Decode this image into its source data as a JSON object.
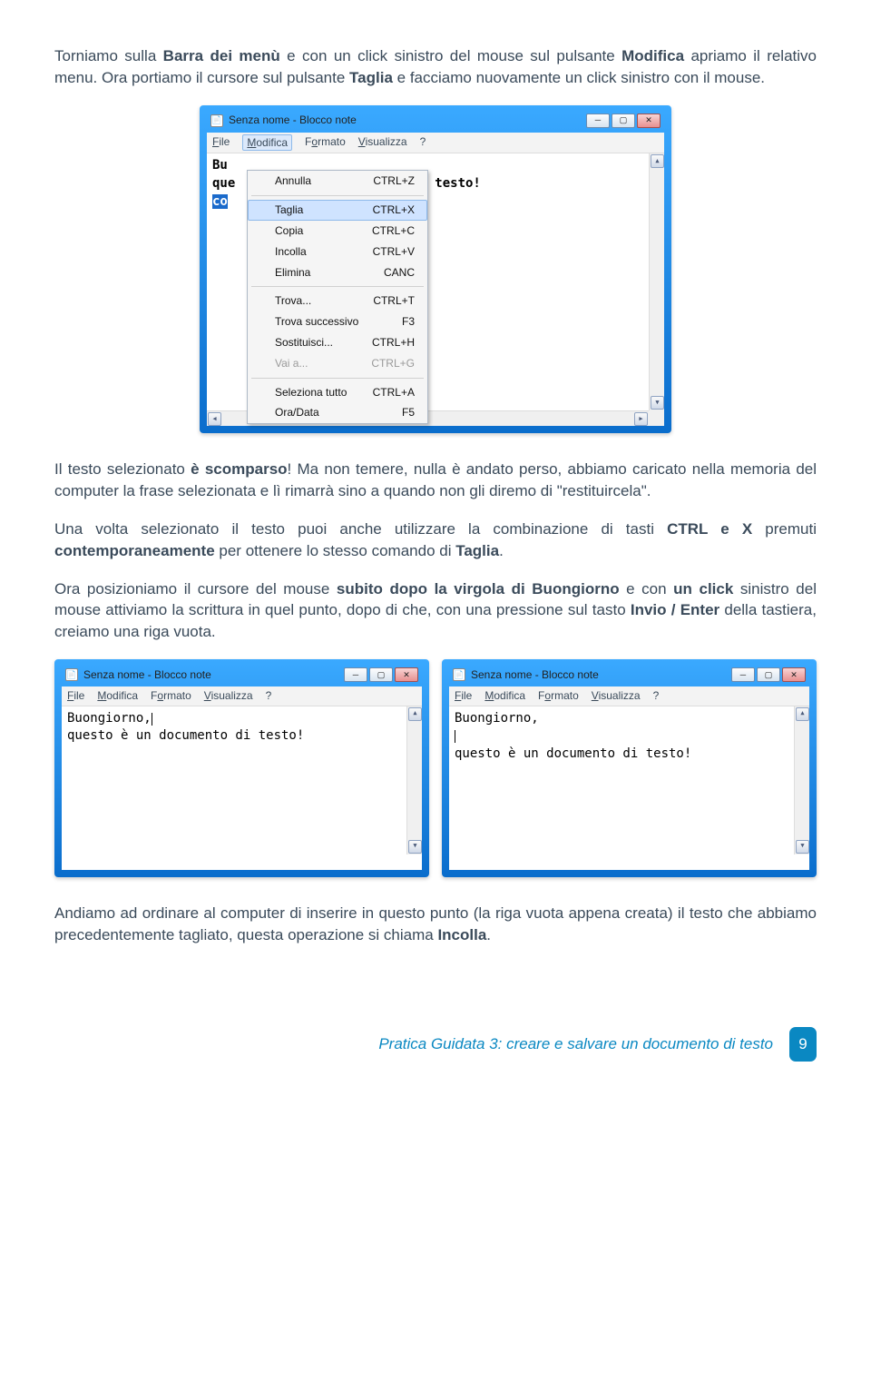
{
  "paragraphs": {
    "p1a": "Torniamo sulla ",
    "p1b": "Barra dei menù",
    "p1c": " e con un click sinistro del mouse sul pulsante ",
    "p1d": "Modifica",
    "p1e": " apriamo il relativo menu. Ora portiamo il cursore sul pulsante ",
    "p1f": "Taglia",
    "p1g": " e facciamo nuovamente un click sinistro con il mouse.",
    "p2a": "Il testo selezionato ",
    "p2b": "è scomparso",
    "p2c": "! Ma non temere, nulla è andato perso, abbiamo caricato nella memoria del computer la frase selezionata e lì rimarrà sino a quando non gli diremo di \"restituircela\".",
    "p3a": "Una volta selezionato il testo puoi anche utilizzare la combinazione di tasti ",
    "p3b": "CTRL e X",
    "p3c": " premuti ",
    "p3d": "contemporaneamente",
    "p3e": " per ottenere lo stesso comando di ",
    "p3f": "Taglia",
    "p3g": ".",
    "p4a": "Ora posizioniamo il cursore del mouse ",
    "p4b": "subito dopo la virgola di Buongiorno",
    "p4c": " e con ",
    "p4d": "un click",
    "p4e": " sinistro del mouse attiviamo la scrittura in quel punto, dopo di che, con una pressione sul tasto ",
    "p4f": "Invio / Enter",
    "p4g": " della tastiera, creiamo una riga vuota.",
    "p5a": "Andiamo ad ordinare al computer di inserire in questo punto (la riga vuota appena creata) il testo che abbiamo precedentemente tagliato, questa operazione si chiama ",
    "p5b": "Incolla",
    "p5c": "."
  },
  "notepad": {
    "title": "Senza nome - Blocco note",
    "menus": {
      "file": "File",
      "modifica": "Modifica",
      "formato": "Formato",
      "visualizza": "Visualizza",
      "help": "?"
    }
  },
  "dropdown": [
    {
      "label": "Annulla",
      "shortcut": "CTRL+Z",
      "gray": false
    },
    {
      "sep": true
    },
    {
      "label": "Taglia",
      "shortcut": "CTRL+X",
      "highlight": true
    },
    {
      "label": "Copia",
      "shortcut": "CTRL+C"
    },
    {
      "label": "Incolla",
      "shortcut": "CTRL+V"
    },
    {
      "label": "Elimina",
      "shortcut": "CANC"
    },
    {
      "sep": true
    },
    {
      "label": "Trova...",
      "shortcut": "CTRL+T"
    },
    {
      "label": "Trova successivo",
      "shortcut": "F3"
    },
    {
      "label": "Sostituisci...",
      "shortcut": "CTRL+H"
    },
    {
      "label": "Vai a...",
      "shortcut": "CTRL+G",
      "gray": true
    },
    {
      "sep": true
    },
    {
      "label": "Seleziona tutto",
      "shortcut": "CTRL+A"
    },
    {
      "label": "Ora/Data",
      "shortcut": "F5"
    }
  ],
  "shot1": {
    "line1_left": "Bu",
    "line2_left": "que",
    "line3_sel": "co",
    "right_text": "di testo!"
  },
  "shot2": {
    "line1": "Buongiorno,",
    "line2": "questo è un documento di testo!"
  },
  "shot3": {
    "line1": "Buongiorno,",
    "line2": "",
    "line3": "questo è un documento di testo!"
  },
  "footer": {
    "text": "Pratica Guidata 3: creare e salvare un documento di testo",
    "page": "9"
  }
}
